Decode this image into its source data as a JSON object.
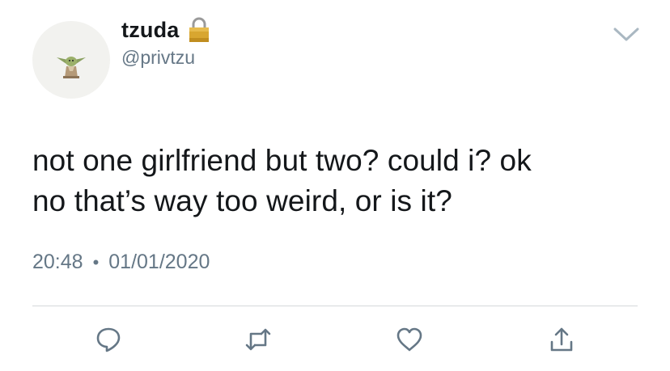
{
  "user": {
    "display_name": "tzuda",
    "handle": "@privtzu",
    "verified_icon": "lock-icon",
    "avatar_icon": "yoda-avatar"
  },
  "tweet": {
    "text_line1": "not one girlfriend but two? could i? ok",
    "text_line2": "no that’s way too weird, or is it?",
    "time": "20:48",
    "separator": "•",
    "date": "01/01/2020"
  },
  "actions": [
    {
      "icon": "reply-icon"
    },
    {
      "icon": "retweet-icon"
    },
    {
      "icon": "like-icon"
    },
    {
      "icon": "share-icon"
    }
  ],
  "colors": {
    "text": "#14171a",
    "secondary": "#657786",
    "icon": "#657786",
    "divider": "#d4d8db"
  }
}
